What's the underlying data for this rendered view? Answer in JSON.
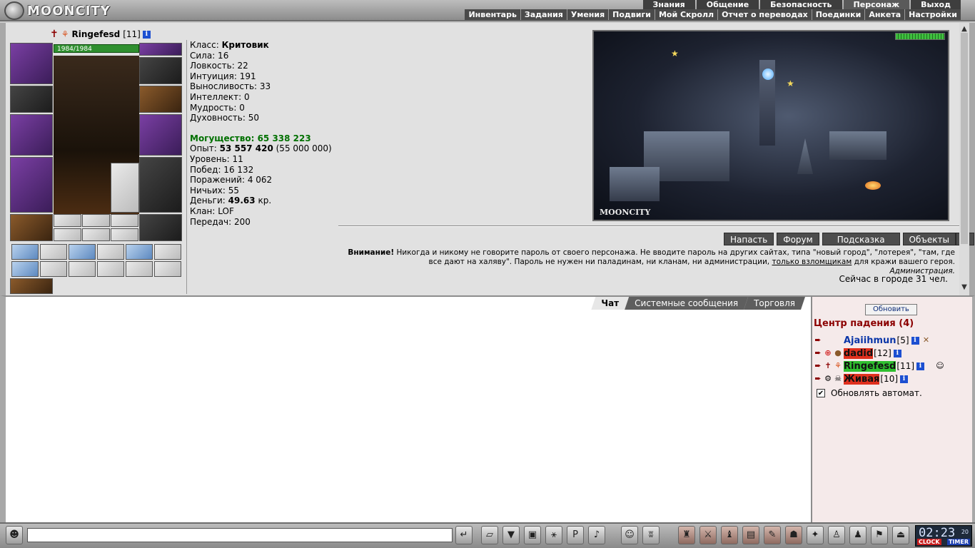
{
  "top_nav": {
    "logo": "MOONCITY",
    "primary": [
      "Знания",
      "Общение",
      "Безопасность",
      "Персонаж",
      "Выход"
    ],
    "secondary": [
      "Инвентарь",
      "Задания",
      "Умения",
      "Подвиги",
      "Мой Скролл",
      "Отчет о переводах",
      "Поединки",
      "Анкета",
      "Настройки"
    ]
  },
  "character": {
    "name": "Ringefesd",
    "level": "[11]",
    "hp": "1984/1984",
    "stats": {
      "class_label": "Класс:",
      "class": "Критовик",
      "lines": [
        "Сила: 16",
        "Ловкость: 22",
        "Интуиция: 191",
        "Выносливость: 33",
        "Интеллект: 0",
        "Мудрость: 0",
        "Духовность: 50"
      ],
      "power": "Могущество: 65 338 223",
      "exp_label": "Опыт:",
      "exp": "53 557 420",
      "exp_next": "(55 000 000)",
      "lines2": [
        "Уровень: 11",
        "Побед: 16 132",
        "Поражений: 4 062",
        "Ничьих: 55"
      ],
      "money_label": "Деньги:",
      "money": "49.63",
      "money_unit": "кр.",
      "lines3": [
        "Клан: LOF",
        "Передач: 200"
      ]
    }
  },
  "scene": {
    "label": "MOONCITY"
  },
  "actions": [
    "Напасть",
    "Форум",
    "Подсказка",
    "Объекты",
    "Δ"
  ],
  "warning": {
    "bold": "Внимание!",
    "text1": " Никогда и никому не говорите пароль от своего персонажа. Не вводите пароль на других сайтах, типа \"новый город\", \"лотерея\", \"там, где все дают на халяву\". Пароль не нужен ни паладинам, ни кланам, ни администрации, ",
    "link": "только взломщикам",
    "text2": " для кражи вашего героя.",
    "signature": "Администрация."
  },
  "online": "Сейчас в городе 31 чел.",
  "chat_tabs": [
    "Чат",
    "Системные сообщения",
    "Торговля"
  ],
  "room": {
    "refresh": "Обновить",
    "title": "Центр падения (4)",
    "users": [
      {
        "name": "Ajaiihmun",
        "level": "[5]"
      },
      {
        "name": "dadid",
        "level": "[12]"
      },
      {
        "name": "Ringefesd",
        "level": "[11]"
      },
      {
        "name": "Живая",
        "level": "[10]"
      }
    ],
    "auto_label": "Обновлять автомат."
  },
  "clock": {
    "time": "02:23",
    "sec": "20",
    "clock_label": "CLOCK",
    "timer_label": "TIMER"
  },
  "colors": {
    "power": "#007000",
    "room_title": "#8b0000",
    "nav_bg": "#3e3e3e"
  }
}
